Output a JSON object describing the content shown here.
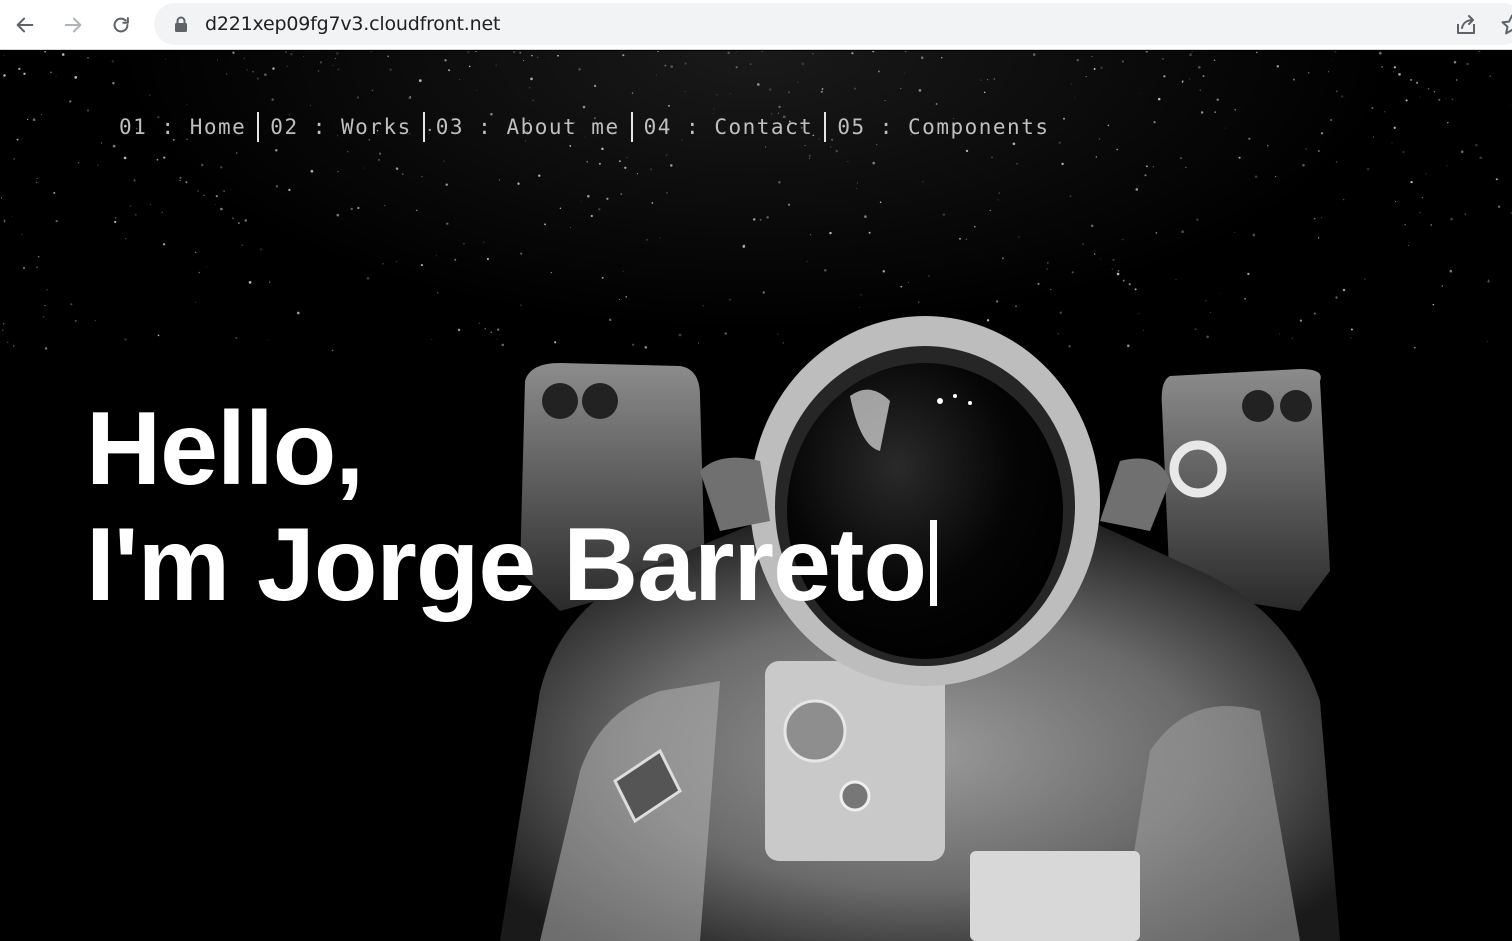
{
  "browser": {
    "url": "d221xep09fg7v3.cloudfront.net",
    "back_icon": "arrow-left-icon",
    "forward_icon": "arrow-right-icon",
    "reload_icon": "reload-icon",
    "lock_icon": "lock-icon",
    "share_icon": "share-icon",
    "bookmark_icon": "star-icon"
  },
  "nav": {
    "items": [
      {
        "label": "01 : Home"
      },
      {
        "label": "02 : Works"
      },
      {
        "label": "03 : About me"
      },
      {
        "label": "04 : Contact"
      },
      {
        "label": "05 : Components"
      }
    ]
  },
  "hero": {
    "line1": "Hello,",
    "line2": "I'm Jorge Barreto"
  },
  "colors": {
    "background": "#000000",
    "text": "#ffffff",
    "nav_text": "#bfbfbf"
  }
}
